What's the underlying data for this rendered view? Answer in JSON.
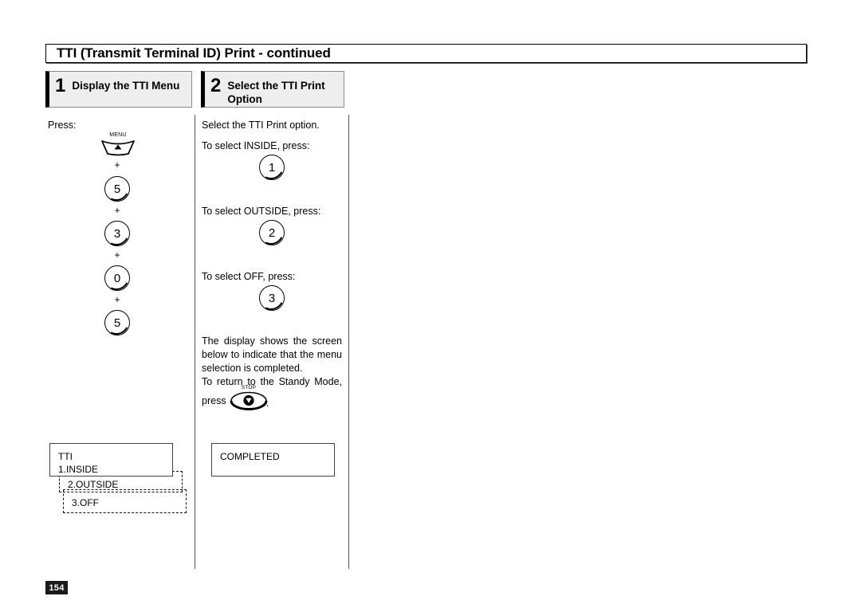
{
  "page": {
    "title": "TTI (Transmit Terminal ID) Print - continued",
    "page_number": "154",
    "page_number_bg": "#1a1a1a",
    "page_number_fg": "#ffffff"
  },
  "steps": [
    {
      "number": "1",
      "label": "Display the TTI Menu"
    },
    {
      "number": "2",
      "label": "Select the TTI Print Option"
    }
  ],
  "left_column": {
    "press_label": "Press:",
    "key_sequence": [
      {
        "type": "menu-key",
        "caption": "MENU",
        "glyph": "up-triangle"
      },
      {
        "type": "plus",
        "label": "+"
      },
      {
        "type": "number-key",
        "label": "5"
      },
      {
        "type": "plus",
        "label": "+"
      },
      {
        "type": "number-key",
        "label": "3"
      },
      {
        "type": "plus",
        "label": "+"
      },
      {
        "type": "number-key",
        "label": "0"
      },
      {
        "type": "plus",
        "label": "+"
      },
      {
        "type": "number-key",
        "label": "5"
      }
    ],
    "displays": [
      {
        "style": "solid",
        "lines": [
          "TTI",
          "1.INSIDE"
        ]
      },
      {
        "style": "dashed",
        "lines": [
          "2.OUTSIDE"
        ]
      },
      {
        "style": "dashed",
        "lines": [
          "3.OFF"
        ]
      }
    ]
  },
  "middle_column": {
    "intro": "Select the TTI Print option.",
    "options": [
      {
        "prompt": "To select INSIDE, press:",
        "key": "1"
      },
      {
        "prompt": "To select OUTSIDE, press:",
        "key": "2"
      },
      {
        "prompt": "To select OFF, press:",
        "key": "3"
      }
    ],
    "note_lines": [
      "The display shows the screen",
      "below to indicate that the menu",
      "selection is completed.",
      "To return to the Standy Mode,"
    ],
    "press_label": "press",
    "press_period": ".",
    "stop_key": {
      "caption": "STOP",
      "glyph": "stop-symbol"
    },
    "display": {
      "style": "solid",
      "lines": [
        "COMPLETED"
      ]
    }
  }
}
